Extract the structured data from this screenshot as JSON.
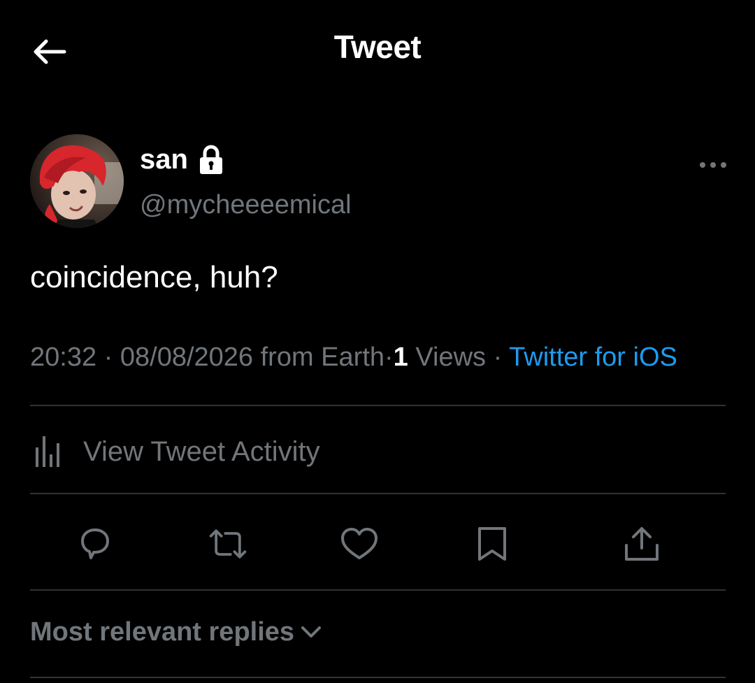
{
  "header": {
    "title": "Tweet",
    "back_icon": "arrow-left-icon"
  },
  "author": {
    "name": "san",
    "handle": "@mycheeeemical",
    "protected_icon": "lock-icon",
    "avatar_hair_color": "#d7262c"
  },
  "tweet": {
    "text": "coincidence, huh?",
    "time": "20:32",
    "date": "08/08/2026",
    "location": "from Earth",
    "views_count": "1",
    "views_label": "Views",
    "source": "Twitter for iOS",
    "sep": "·"
  },
  "activity": {
    "label": "View Tweet Activity",
    "icon": "bar-chart-icon"
  },
  "actions": [
    {
      "name": "reply",
      "icon": "reply-icon"
    },
    {
      "name": "retweet",
      "icon": "retweet-icon"
    },
    {
      "name": "like",
      "icon": "heart-icon"
    },
    {
      "name": "bookmark",
      "icon": "bookmark-icon"
    },
    {
      "name": "share",
      "icon": "share-icon"
    }
  ],
  "replies": {
    "sort_label": "Most relevant replies",
    "chevron_icon": "chevron-down-icon"
  },
  "colors": {
    "background": "#000000",
    "text_primary": "#ffffff",
    "text_secondary": "#71767b",
    "accent": "#1d9bf0",
    "divider": "#2f3336"
  }
}
